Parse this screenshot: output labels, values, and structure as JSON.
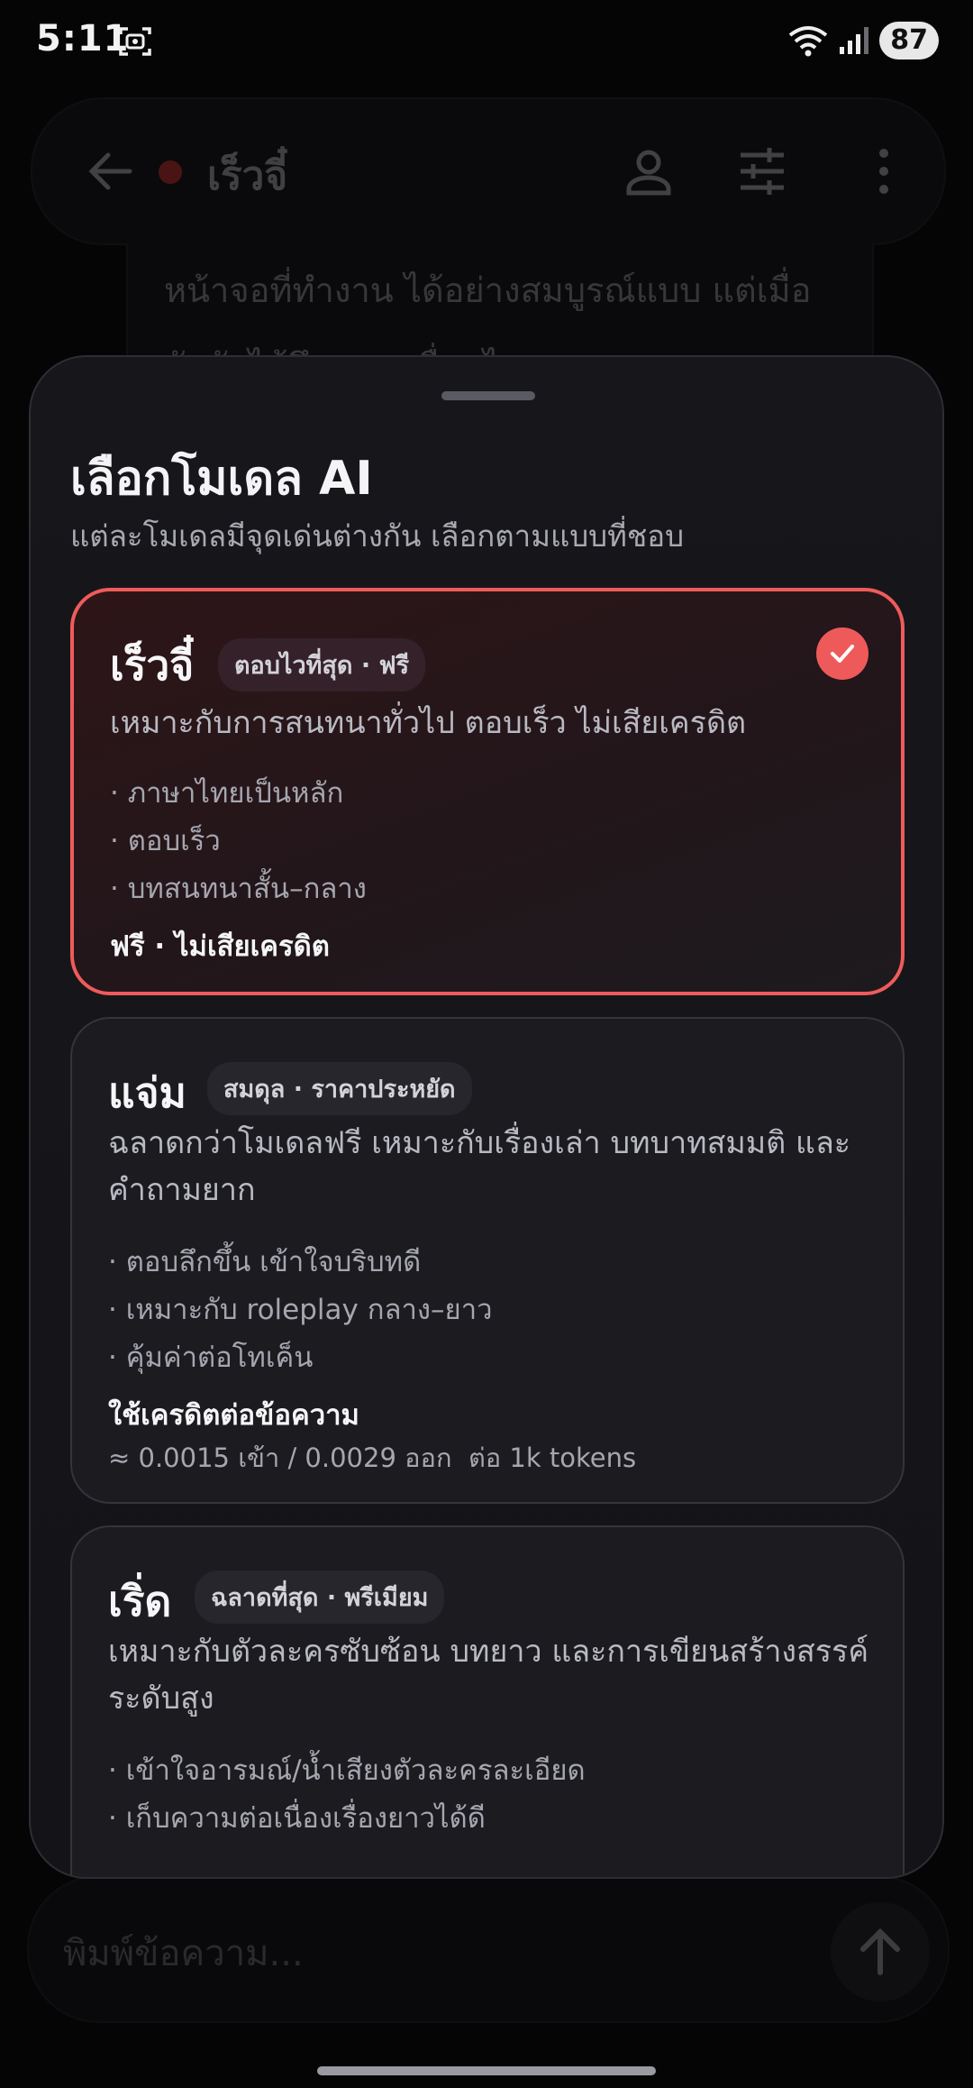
{
  "status": {
    "time": "5:11",
    "battery": "87"
  },
  "chat": {
    "title": "เร็วจี๋",
    "message_text": "หน้าจอที่ทำงาน ได้อย่างสมบูรณ์แบบ แต่เมื่อสัมผัสได้ถึงการเคลื่อนไหวของ",
    "composer_placeholder": "พิมพ์ข้อความ..."
  },
  "sheet": {
    "title": "เลือกโมเดล AI",
    "subtitle": "แต่ละโมเดลมีจุดเด่นต่างกัน เลือกตามแบบที่ชอบ",
    "models": [
      {
        "name": "เร็วจี๋",
        "badge": "ตอบไวที่สุด · ฟรี",
        "description": "เหมาะกับการสนทนาทั่วไป ตอบเร็ว ไม่เสียเครดิต",
        "features": [
          "· ภาษาไทยเป็นหลัก",
          "· ตอบเร็ว",
          "· บทสนทนาสั้น–กลาง"
        ],
        "price": "ฟรี · ไม่เสียเครดิต",
        "rate": "",
        "selected": true
      },
      {
        "name": "แจ่ม",
        "badge": "สมดุล · ราคาประหยัด",
        "description": "ฉลาดกว่าโมเดลฟรี เหมาะกับเรื่องเล่า บทบาทสมมติ และคำถามยาก",
        "features": [
          "· ตอบลึกขึ้น เข้าใจบริบทดี",
          "· เหมาะกับ roleplay กลาง–ยาว",
          "· คุ้มค่าต่อโทเค็น"
        ],
        "price": "ใช้เครดิตต่อข้อความ",
        "rate": "≈ 0.0015 เข้า / 0.0029 ออก  ต่อ 1k tokens",
        "selected": false
      },
      {
        "name": "เริ่ด",
        "badge": "ฉลาดที่สุด · พรีเมียม",
        "description": "เหมาะกับตัวละครซับซ้อน บทยาว และการเขียนสร้างสรรค์ระดับสูง",
        "features": [
          "· เข้าใจอารมณ์/น้ำเสียงตัวละครละเอียด",
          "· เก็บความต่อเนื่องเรื่องยาวได้ดี"
        ],
        "price": "",
        "rate": "",
        "selected": false
      }
    ]
  },
  "colors": {
    "accent": "#ef5b5b",
    "background": "#050506",
    "sheet": "#17171b"
  }
}
